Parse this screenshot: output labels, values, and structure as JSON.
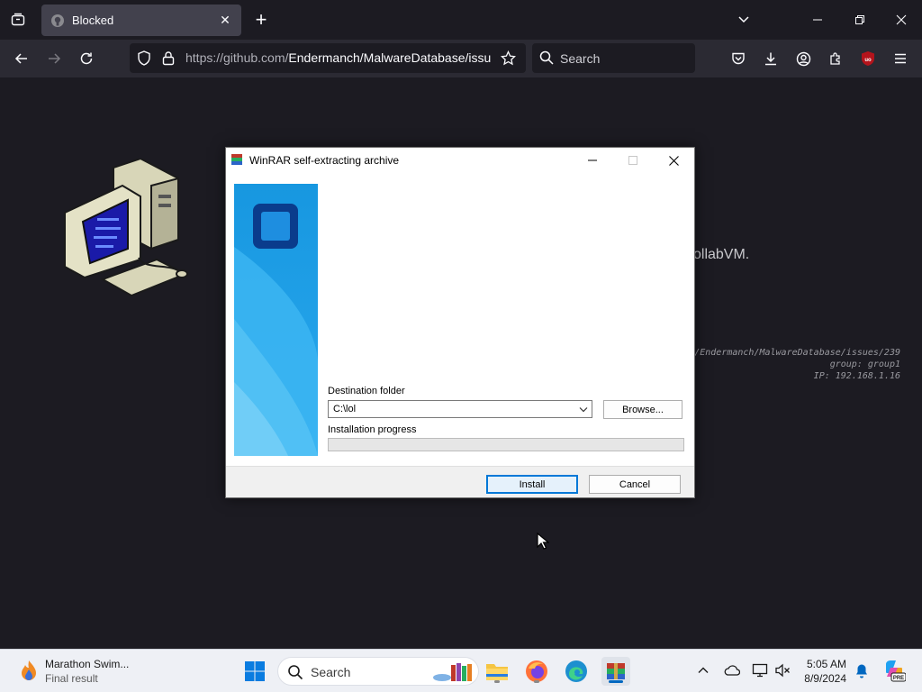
{
  "browser": {
    "tab": {
      "title": "Blocked"
    },
    "url": {
      "host": "https://github.com/",
      "path": "Endermanch/MalwareDatabase/issu"
    },
    "search_placeholder": "Search",
    "extension_badge": "uo"
  },
  "page": {
    "partial_text": "ollabVM.",
    "info_lines": [
      "/Endermanch/MalwareDatabase/issues/239",
      "group: group1",
      "IP: 192.168.1.16"
    ]
  },
  "dialog": {
    "title": "WinRAR self-extracting archive",
    "destination_label": "Destination folder",
    "destination_value": "C:\\lol",
    "browse_label": "Browse...",
    "progress_label": "Installation progress",
    "progress_value": 0,
    "install_label": "Install",
    "cancel_label": "Cancel"
  },
  "taskbar": {
    "widget_title": "Marathon Swim...",
    "widget_subtitle": "Final result",
    "search_placeholder": "Search",
    "time": "5:05 AM",
    "date": "8/9/2024"
  },
  "colors": {
    "browser_bg": "#1c1b22",
    "toolbar_bg": "#2b2a33",
    "dialog_accent": "#0078d7",
    "banner_blue": "#1ba1e2"
  }
}
